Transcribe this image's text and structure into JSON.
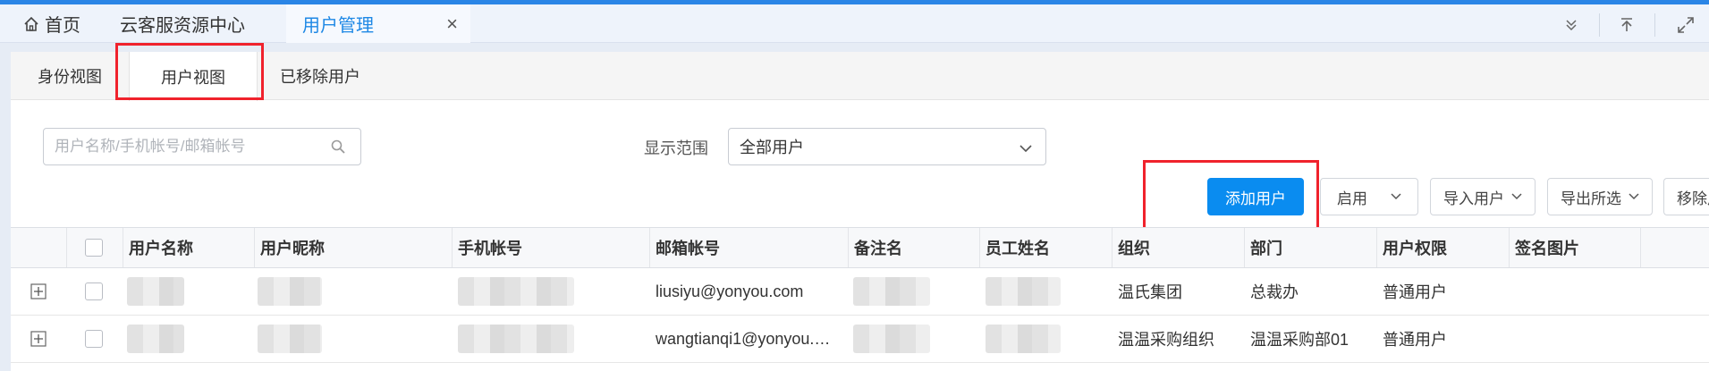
{
  "tabbar": {
    "home_label": "首页",
    "resource_center_label": "云客服资源中心",
    "active_tab_label": "用户管理",
    "close_symbol": "×"
  },
  "subtabs": {
    "identity_view": "身份视图",
    "user_view": "用户视图",
    "removed_users": "已移除用户"
  },
  "search": {
    "placeholder": "用户名称/手机帐号/邮箱帐号"
  },
  "filter": {
    "label": "显示范围",
    "selected": "全部用户"
  },
  "toolbar": {
    "add_user": "添加用户",
    "enable": "启用",
    "import_users": "导入用户",
    "export_selected": "导出所选",
    "remove": "移除用户"
  },
  "table": {
    "columns": [
      "用户名称",
      "用户昵称",
      "手机帐号",
      "邮箱帐号",
      "备注名",
      "员工姓名",
      "组织",
      "部门",
      "用户权限",
      "签名图片"
    ],
    "rows": [
      {
        "email": "liusiyu@yonyou.com",
        "org": "温氏集团",
        "dept": "总裁办",
        "permission": "普通用户"
      },
      {
        "email": "wangtianqi1@yonyou.…",
        "org": "温温采购组织",
        "dept": "温温采购部01",
        "permission": "普通用户"
      }
    ]
  },
  "colors": {
    "accent": "#0a8cf0",
    "highlight": "#f0222c",
    "active_tab_text": "#1e88e5"
  }
}
